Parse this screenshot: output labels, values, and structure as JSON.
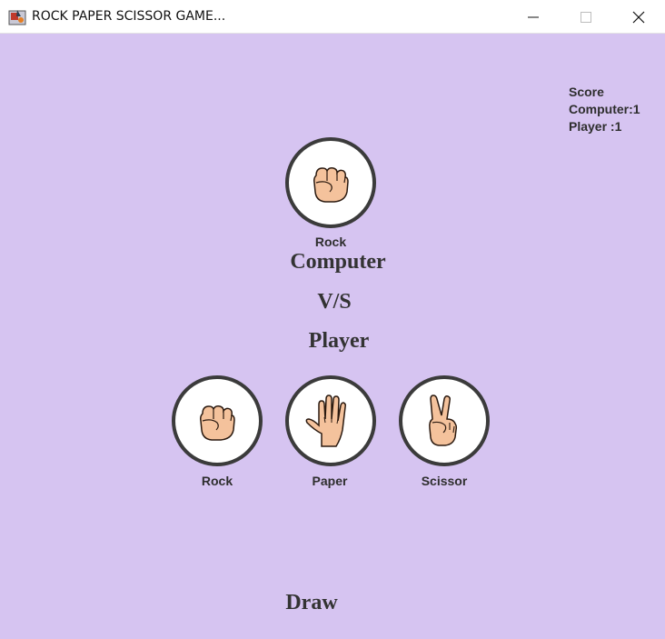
{
  "window": {
    "title": "ROCK PAPER SCISSOR GAME...",
    "icon": "java-app-icon"
  },
  "score": {
    "heading": "Score",
    "computer": "Computer:1",
    "player": "Player :1"
  },
  "computer_choice": {
    "label": "Rock",
    "icon": "rock-hand-icon"
  },
  "headings": {
    "computer": "Computer",
    "vs": "V/S",
    "player": "Player"
  },
  "player_choices": [
    {
      "label": "Rock",
      "icon": "rock-hand-icon"
    },
    {
      "label": "Paper",
      "icon": "paper-hand-icon"
    },
    {
      "label": "Scissor",
      "icon": "scissor-hand-icon"
    }
  ],
  "result": "Draw",
  "colors": {
    "background": "#d6c4f1",
    "circle_border": "#3b3b3b",
    "skin": "#f4c29c",
    "text": "#333333"
  }
}
